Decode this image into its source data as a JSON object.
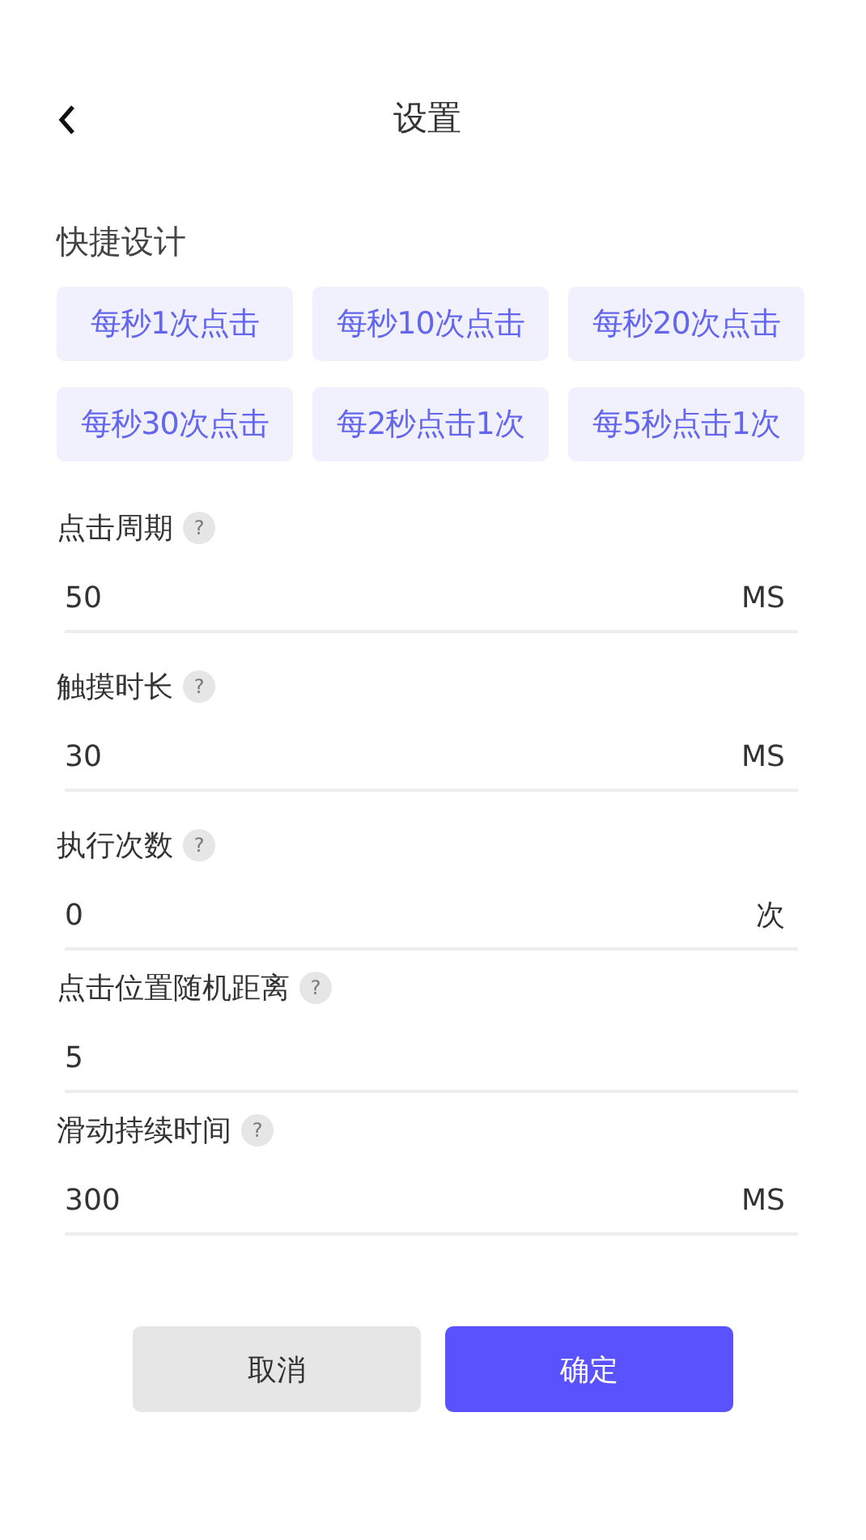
{
  "header": {
    "title": "设置"
  },
  "quick": {
    "title": "快捷设计",
    "presets": [
      {
        "label": "每秒1次点击"
      },
      {
        "label": "每秒10次点击"
      },
      {
        "label": "每秒20次点击"
      },
      {
        "label": "每秒30次点击"
      },
      {
        "label": "每2秒点击1次"
      },
      {
        "label": "每5秒点击1次"
      }
    ]
  },
  "fields": [
    {
      "label": "点击周期",
      "help": "?",
      "value": "50",
      "unit": "MS"
    },
    {
      "label": "触摸时长",
      "help": "?",
      "value": "30",
      "unit": "MS"
    },
    {
      "label": "执行次数",
      "help": "?",
      "value": "0",
      "unit": "次"
    },
    {
      "label": "点击位置随机距离",
      "help": "?",
      "value": "5"
    },
    {
      "label": "滑动持续时间",
      "help": "?",
      "value": "300",
      "unit": "MS"
    }
  ],
  "buttons": [
    {
      "label": "取消",
      "kind": "secondary"
    },
    {
      "label": "确定",
      "kind": "primary"
    }
  ]
}
